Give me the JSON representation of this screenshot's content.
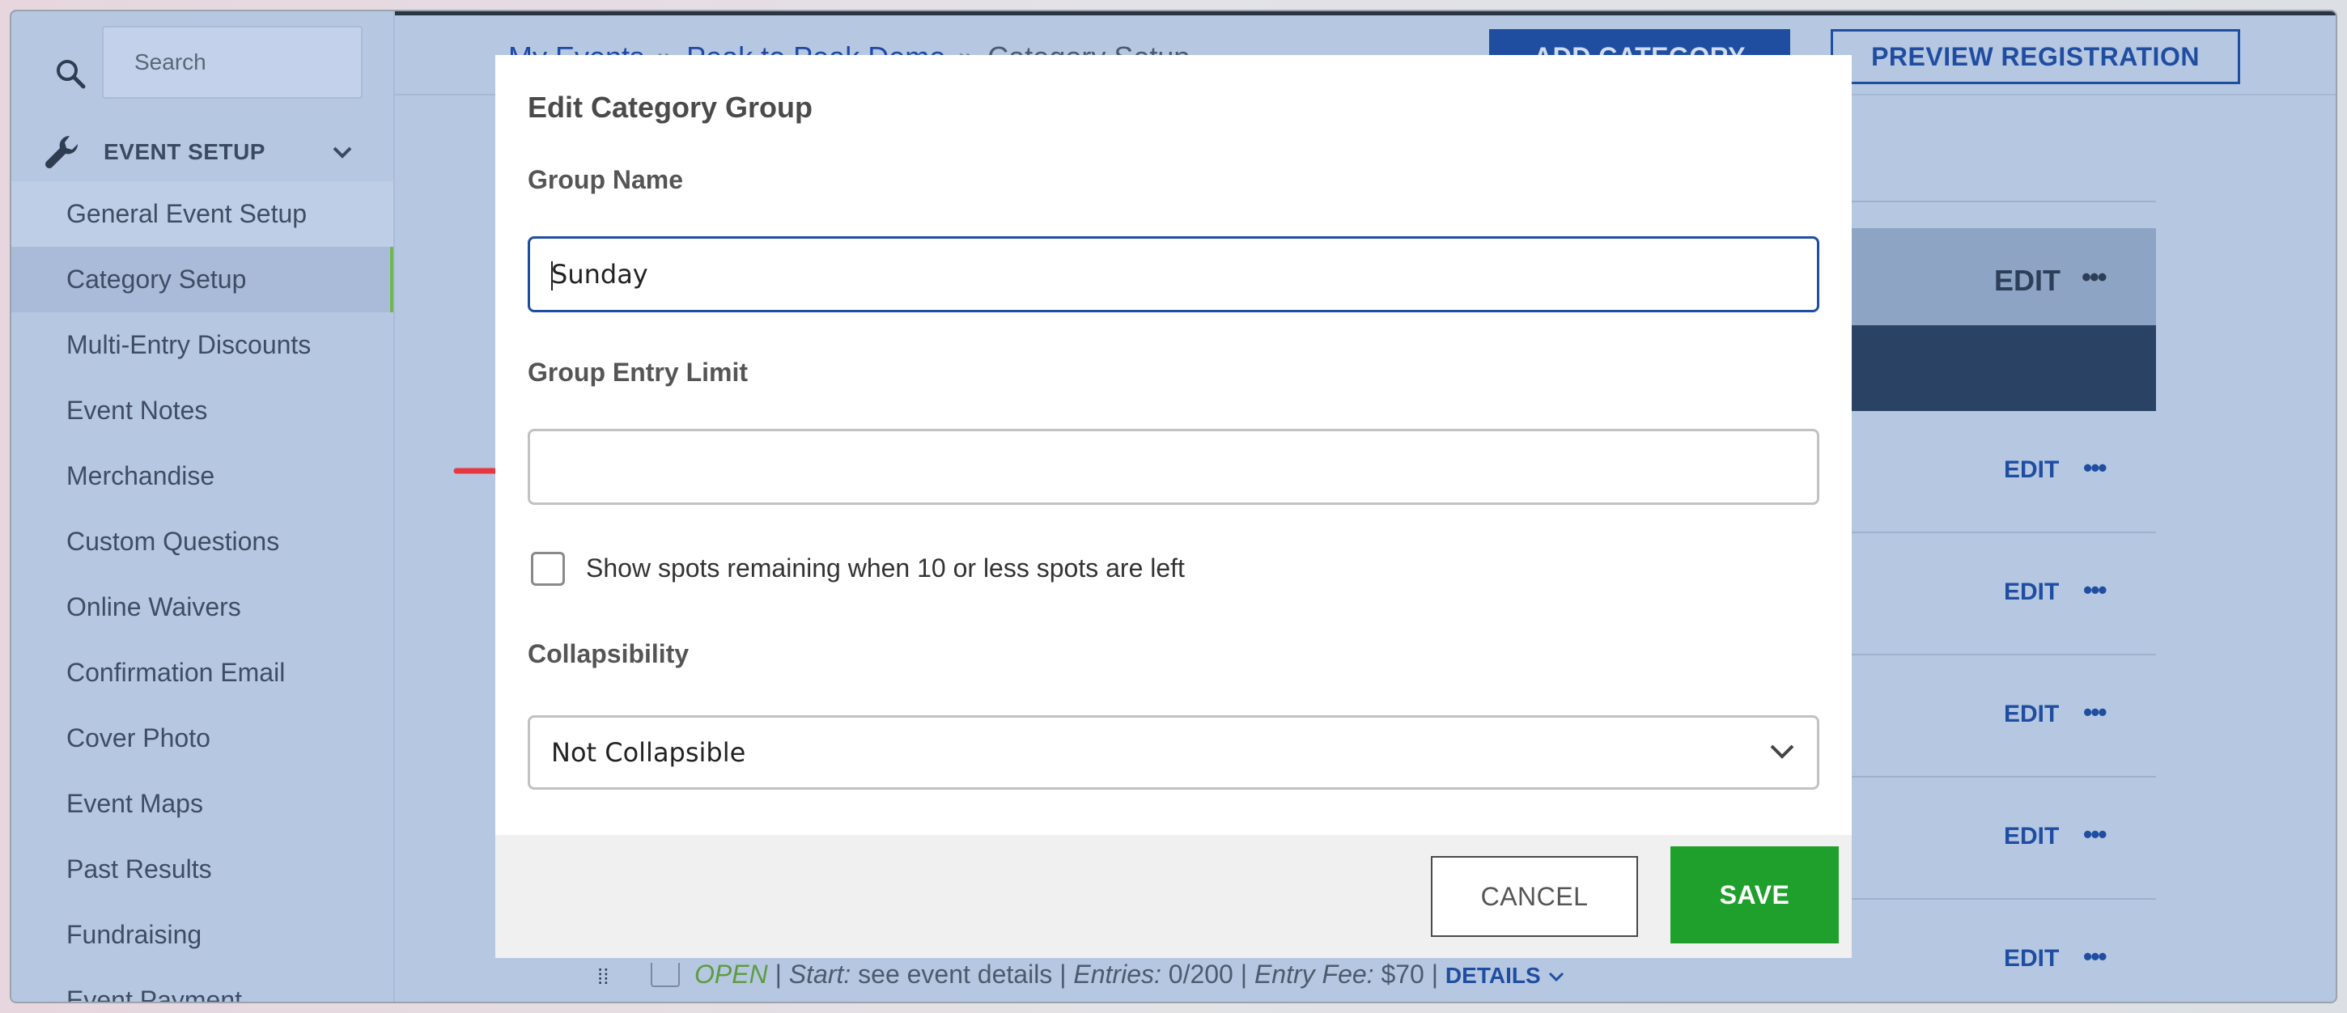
{
  "sidebar": {
    "search_placeholder": "Search",
    "section_label": "EVENT SETUP",
    "items": [
      {
        "label": "General Event Setup"
      },
      {
        "label": "Category Setup"
      },
      {
        "label": "Multi-Entry Discounts"
      },
      {
        "label": "Event Notes"
      },
      {
        "label": "Merchandise"
      },
      {
        "label": "Custom Questions"
      },
      {
        "label": "Online Waivers"
      },
      {
        "label": "Confirmation Email"
      },
      {
        "label": "Cover Photo"
      },
      {
        "label": "Event Maps"
      },
      {
        "label": "Past Results"
      },
      {
        "label": "Fundraising"
      },
      {
        "label": "Event Payment"
      }
    ]
  },
  "header": {
    "breadcrumb": [
      "My Events",
      "Peak to Peak Demo",
      "Category Setup"
    ],
    "separator": "»",
    "add_category_label": "ADD CATEGORY",
    "preview_label": "PREVIEW REGISTRATION"
  },
  "background": {
    "edit_label": "EDIT",
    "more_label": "•••",
    "row_edit_labels": [
      "EDIT",
      "EDIT",
      "EDIT",
      "EDIT",
      "EDIT"
    ],
    "bottom_row": {
      "status": "OPEN",
      "start_label": "Start:",
      "start_value": "see event details",
      "entries_label": "Entries:",
      "entries_value": "0/200",
      "fee_label": "Entry Fee:",
      "fee_value": "$70",
      "details_label": "DETAILS"
    }
  },
  "modal": {
    "title": "Edit Category Group",
    "group_name_label": "Group Name",
    "group_name_value": "Sunday",
    "entry_limit_label": "Group Entry Limit",
    "entry_limit_value": "",
    "checkbox_label": "Show spots remaining when 10 or less spots are left",
    "checkbox_checked": false,
    "collapsibility_label": "Collapsibility",
    "collapsibility_value": "Not Collapsible",
    "cancel_label": "CANCEL",
    "save_label": "SAVE"
  },
  "colors": {
    "accent_blue": "#1f4ea1",
    "save_green": "#1f9f2b",
    "annotation_arrow": "#e8383f",
    "active_indicator": "#6fb84f"
  }
}
